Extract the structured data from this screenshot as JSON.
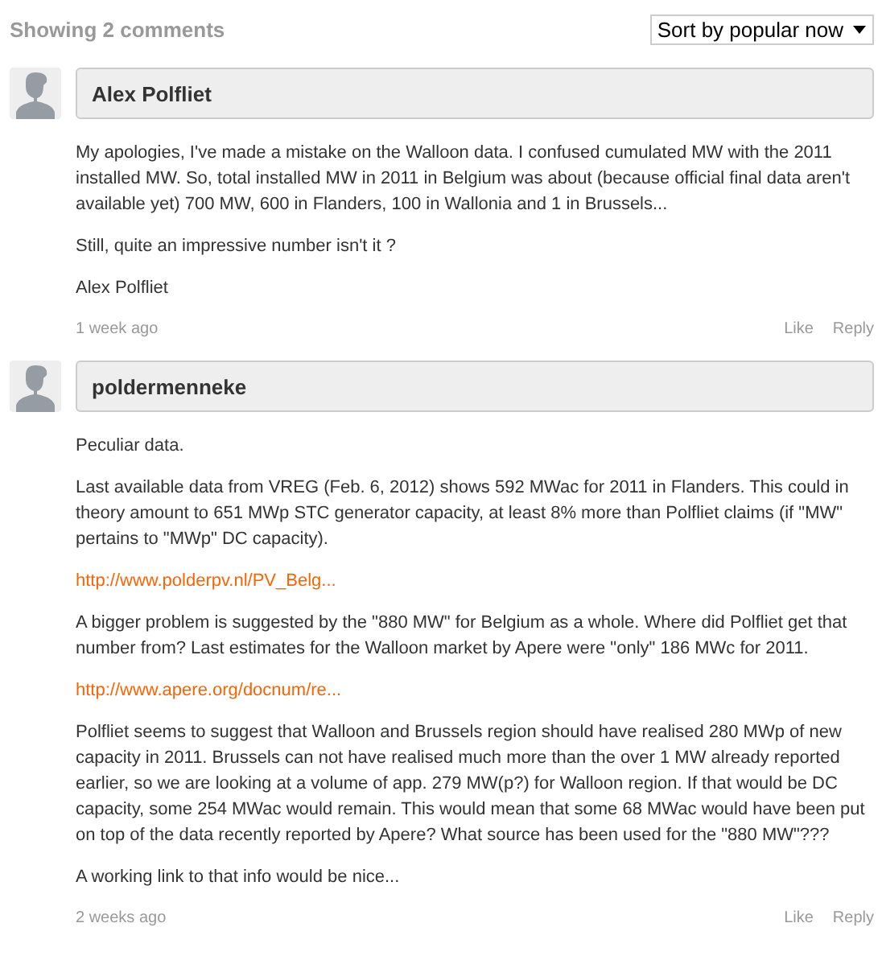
{
  "header": {
    "count": "Showing 2 comments",
    "sort": "Sort by popular now"
  },
  "comments": [
    {
      "author": "Alex Polfliet",
      "time": "1 week ago",
      "actions": [
        "Like",
        "Reply"
      ],
      "paragraphs": [
        {
          "kind": "text",
          "text": "My apologies, I've made a mistake on the Walloon data. I confused cumulated MW with the 2011 installed MW. So, total installed MW in 2011 in Belgium was about (because official  final data aren't available yet) 700 MW, 600 in Flanders, 100 in Wallonia and 1 in Brussels..."
        },
        {
          "kind": "text",
          "text": "Still, quite an impressive number isn't it ?"
        },
        {
          "kind": "text",
          "text": "Alex Polfliet"
        }
      ]
    },
    {
      "author": "poldermenneke",
      "time": "2 weeks ago",
      "actions": [
        "Like",
        "Reply"
      ],
      "paragraphs": [
        {
          "kind": "text",
          "text": "Peculiar data."
        },
        {
          "kind": "text",
          "text": "Last available data from VREG (Feb. 6, 2012) shows 592 MWac for 2011 in Flanders. This could in theory amount to 651 MWp STC generator capacity, at least 8% more than Polfliet claims (if \"MW\" pertains to \"MWp\" DC capacity)."
        },
        {
          "kind": "link",
          "text": "http://www.polderpv.nl/PV_Belg..."
        },
        {
          "kind": "text",
          "text": "A bigger problem is suggested by the \"880 MW\" for Belgium as a whole. Where did Polfliet get that number from? Last estimates for the Walloon market by Apere were \"only\" 186 MWc for 2011."
        },
        {
          "kind": "link",
          "text": "http://www.apere.org/docnum/re..."
        },
        {
          "kind": "text",
          "text": "Polfliet seems to suggest that Walloon and Brussels region should have realised 280 MWp of new capacity in 2011. Brussels can not have realised much more than the over 1 MW already reported earlier, so we are looking at a volume of app. 279 MW(p?) for Walloon region. If that would be DC capacity, some 254 MWac would remain. This would mean that some 68 MWac would have been put on top of the data recently reported by Apere? What source has been used for the \"880 MW\"???"
        },
        {
          "kind": "text",
          "text": "A working link to that info would be nice..."
        }
      ]
    }
  ]
}
